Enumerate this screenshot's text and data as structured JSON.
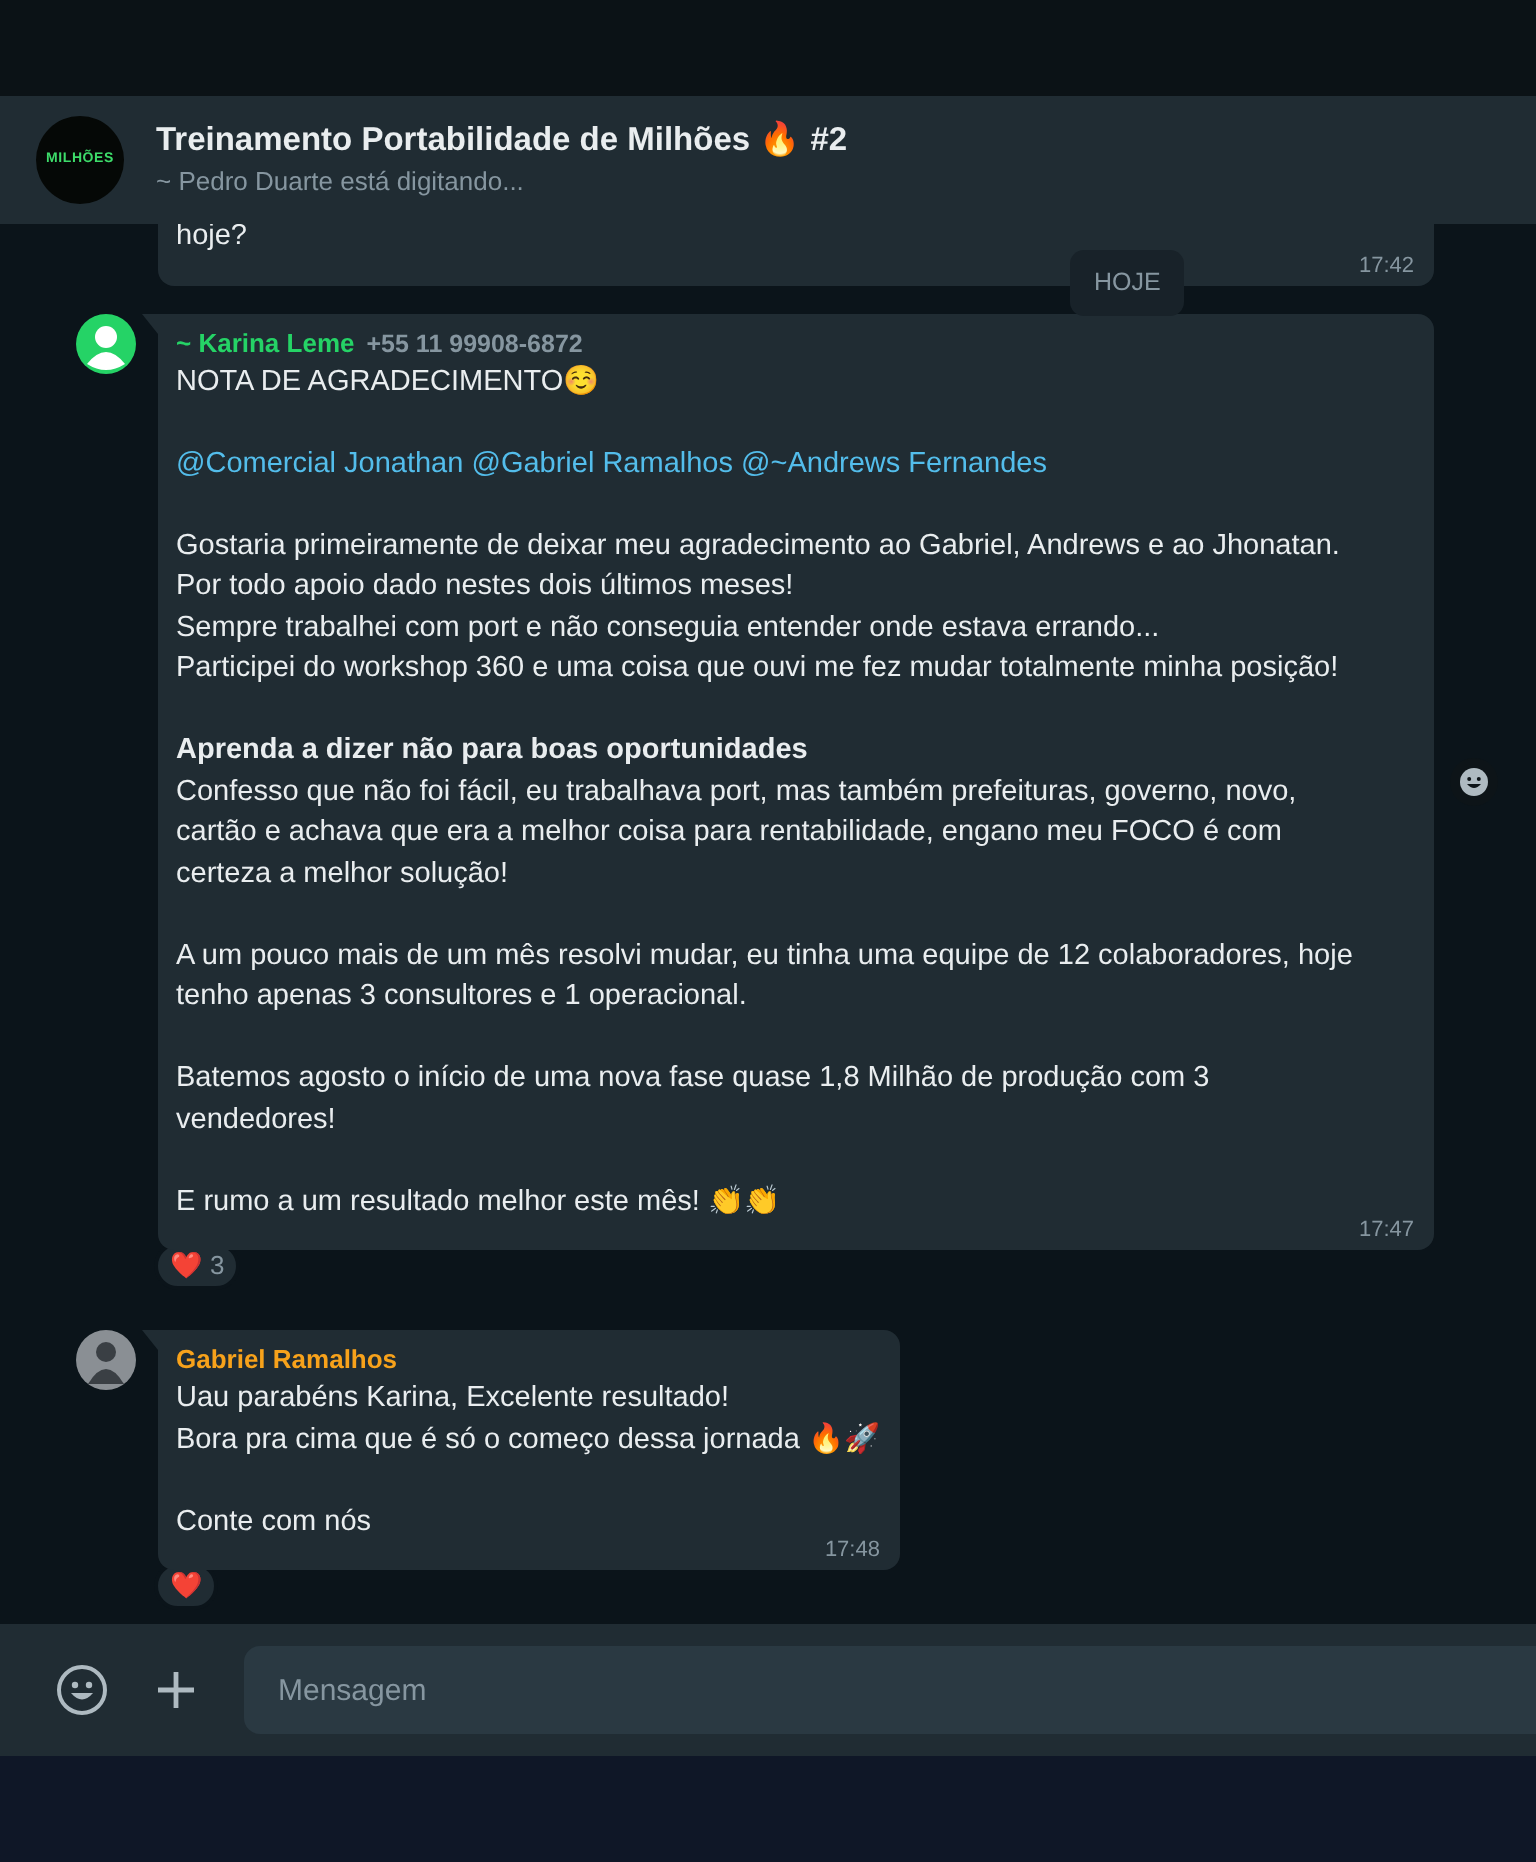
{
  "header": {
    "logo_text": "MILHÕES",
    "title": "Treinamento Portabilidade de Milhões 🔥 #2",
    "subtitle": "~ Pedro Duarte está digitando..."
  },
  "date_chip": "HOJE",
  "messages": [
    {
      "kind": "partial",
      "paragraphs": [
        [
          "hoje?"
        ]
      ],
      "time": "17:42"
    },
    {
      "kind": "full",
      "has_photo": false,
      "sender": "~ Karina Leme",
      "color": "#25d366",
      "phone": "+55 11 99908-6872",
      "paragraphs": [
        [
          "NOTA DE AGRADECIMENTO☺️"
        ],
        {
          "mentions": [
            "@Comercial Jonathan",
            "@Gabriel Ramalhos",
            "@~Andrews Fernandes"
          ]
        },
        [
          "Gostaria primeiramente de deixar meu agradecimento ao Gabriel, Andrews e ao Jhonatan.",
          "Por todo apoio dado nestes dois últimos meses!",
          "Sempre trabalhei com port e não conseguia entender onde estava errando...",
          "Participei do workshop 360 e uma coisa que ouvi me fez mudar totalmente minha posição!"
        ],
        [
          "**Aprenda a dizer não para boas oportunidades**",
          "Confesso que não foi fácil, eu trabalhava port, mas também prefeituras, governo, novo,",
          "cartão e achava que era a melhor coisa para rentabilidade, engano meu FOCO é com",
          "certeza a melhor solução!"
        ],
        [
          "A um pouco mais de um mês resolvi mudar, eu tinha uma equipe de 12 colaboradores, hoje",
          "tenho apenas 3 consultores e 1 operacional."
        ],
        [
          "Batemos agosto o início de uma nova fase quase 1,8 Milhão de produção com 3",
          "vendedores!"
        ],
        [
          "E rumo a um resultado melhor este mês! 👏👏"
        ]
      ],
      "time": "17:47",
      "reaction": {
        "emoji": "❤️",
        "count": "3"
      }
    },
    {
      "kind": "full",
      "has_photo": true,
      "sender": "Gabriel Ramalhos",
      "color": "#f7a21b",
      "paragraphs": [
        [
          "Uau parabéns Karina, Excelente resultado!",
          "Bora pra cima que é só o começo dessa jornada 🔥🚀"
        ],
        [
          "Conte com nós"
        ]
      ],
      "time": "17:48",
      "reaction": {
        "emoji": "❤️"
      }
    }
  ],
  "composer": {
    "placeholder": "Mensagem"
  }
}
